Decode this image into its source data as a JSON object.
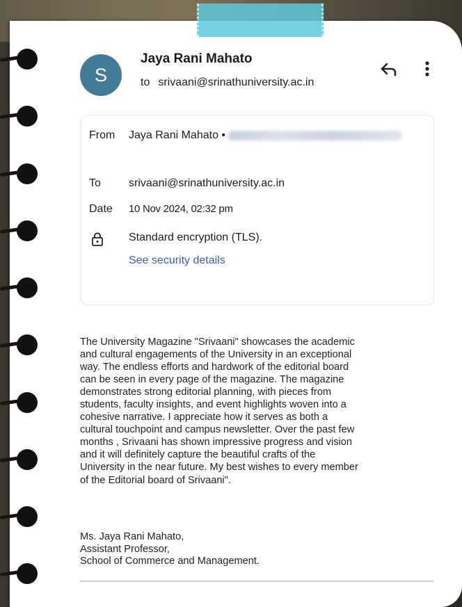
{
  "email": {
    "sender_initial": "S",
    "sender_name": "Jaya Rani Mahato",
    "to_label": "to",
    "to_address": "srivaani@srinathuniversity.ac.in",
    "icons": {
      "reply": "reply-icon",
      "more": "more-vert-icon",
      "lock": "lock-icon"
    },
    "avatar_color": "#417b96"
  },
  "details": {
    "from_label": "From",
    "from_name": "Jaya Rani Mahato •",
    "to_label": "To",
    "to_value": "srivaani@srinathuniversity.ac.in",
    "date_label": "Date",
    "date_value": "10 Nov 2024, 02:32 pm",
    "encryption": "Standard encryption (TLS).",
    "security_link": "See security details",
    "link_color": "#3f5bb0"
  },
  "body": {
    "lines": [
      "The University Magazine \"Srivaani\" showcases the academic",
      "and cultural engagements of the University in an exceptional",
      "way. The endless efforts and  hardwork of the editorial board",
      "can be seen in every page of the magazine. The magazine",
      "demonstrates strong editorial planning, with pieces from",
      "students, faculty insights, and event highlights woven into a",
      "cohesive narrative. I appreciate how it serves as both a",
      "cultural touchpoint and campus newsletter. Over the past few",
      "months , Srivaani has shown impressive progress and vision",
      "and it will definitely capture the beautiful crafts of the",
      "University in the near future. My best wishes to every member",
      "of the Editorial board of Srivaani\"."
    ],
    "signature": [
      "Ms. Jaya Rani Mahato,",
      "Assistant Professor,",
      "School of Commerce and Management."
    ]
  }
}
